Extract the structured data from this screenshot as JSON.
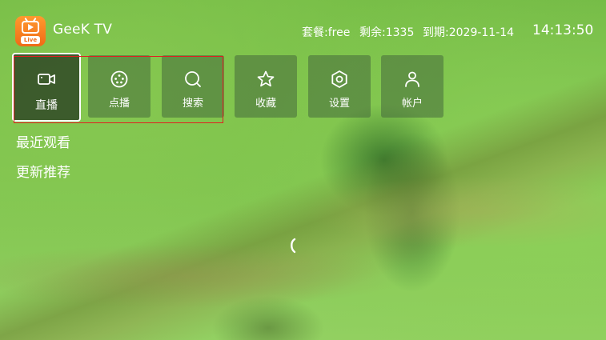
{
  "app": {
    "logo_badge": "Live",
    "title": "GeeK TV"
  },
  "header": {
    "plan": "套餐:free",
    "remaining": "剩余:1335",
    "expires": "到期:2029-11-14",
    "clock": "14:13:50"
  },
  "menu": {
    "items": [
      {
        "label": "直播",
        "icon": "video-camera-icon",
        "selected": true
      },
      {
        "label": "点播",
        "icon": "film-reel-icon",
        "selected": false
      },
      {
        "label": "搜索",
        "icon": "search-icon",
        "selected": false
      },
      {
        "label": "收藏",
        "icon": "star-icon",
        "selected": false
      },
      {
        "label": "设置",
        "icon": "hexagon-settings-icon",
        "selected": false
      },
      {
        "label": "帐户",
        "icon": "user-icon",
        "selected": false
      }
    ]
  },
  "sections": {
    "recent": "最近观看",
    "updates": "更新推荐"
  },
  "colors": {
    "background": "#7cc64e",
    "logo": "#f06a16",
    "highlight": "#e02020",
    "tile": "#46693c"
  }
}
